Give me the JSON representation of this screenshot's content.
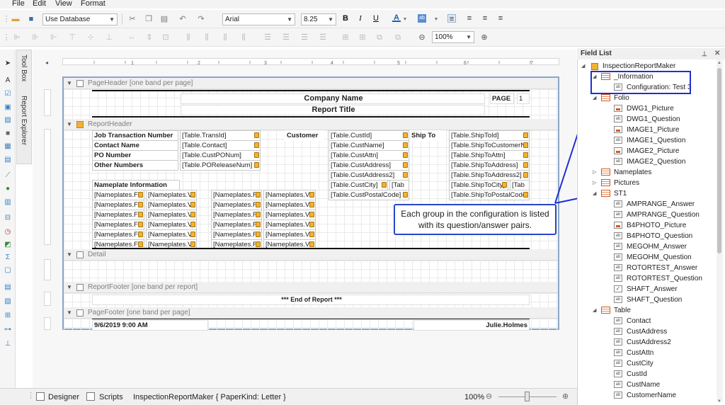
{
  "menu": [
    "File",
    "Edit",
    "View",
    "Format"
  ],
  "toolbar1": {
    "datasource": "Use Database",
    "font": "Arial",
    "size": "8.25",
    "bold": "B",
    "italic": "I",
    "underline": "U",
    "fontcolor": "A"
  },
  "toolbar2": {
    "zoom": "100%"
  },
  "vtabs": [
    "Tool Box",
    "Report Explorer"
  ],
  "bands": {
    "pageheader": "PageHeader [one band per page]",
    "reportheader": "ReportHeader",
    "detail": "Detail",
    "reportfooter": "ReportFooter [one band per report]",
    "pagefooter": "PageFooter [one band per page]"
  },
  "header": {
    "company": "Company Name",
    "title": "Report Title",
    "page": "PAGE",
    "pagenum": "1"
  },
  "rh": {
    "labels": [
      "Job Transaction Number",
      "Contact Name",
      "PO Number",
      "Other Numbers"
    ],
    "values": [
      "[Table.TransId]",
      "[Table.Contact]",
      "[Table.CustPONum]",
      "[Table.POReleaseNum]"
    ],
    "customer_lbl": "Customer",
    "customer": [
      "[Table.CustId]",
      "[Table.CustName]",
      "[Table.CustAttn]",
      "[Table.CustAddress]",
      "[Table.CustAddress2]",
      "[Table.CustCity]",
      "[Table.CustPostalCode]"
    ],
    "shipto_lbl": "Ship To",
    "shipto": [
      "[Table.ShipToId]",
      "[Table.ShipToCustomerN",
      "[Table.ShipToAttn]",
      "[Table.ShipToAddress]",
      "[Table.ShipToAddress2]",
      "[Table.ShipToCity]",
      "[Table.ShipToPostalCode"
    ],
    "tab": "[Tab",
    "nameplate_lbl": "Nameplate Information",
    "np_f": "[Nameplates.F",
    "np_v": "[Nameplates.V"
  },
  "footer": {
    "end": "*** End of Report ***",
    "date": "9/6/2019 9:00 AM",
    "user": "Julie.Holmes"
  },
  "callout": "Each group in the configuration is listed with its question/answer pairs.",
  "fieldlist": {
    "title": "Field List",
    "root": "InspectionReportMaker",
    "items": [
      {
        "lvl": 1,
        "icon": "tbl",
        "caret": "open",
        "text": "_Information"
      },
      {
        "lvl": 2,
        "icon": "ab",
        "caret": "",
        "text": "Configuration: Test 3"
      },
      {
        "lvl": 1,
        "icon": "tbl",
        "caret": "open",
        "text": "Folio"
      },
      {
        "lvl": 2,
        "icon": "pic",
        "caret": "",
        "text": "DWG1_Picture"
      },
      {
        "lvl": 2,
        "icon": "ab",
        "caret": "",
        "text": "DWG1_Question"
      },
      {
        "lvl": 2,
        "icon": "pic",
        "caret": "",
        "text": "IMAGE1_Picture"
      },
      {
        "lvl": 2,
        "icon": "ab",
        "caret": "",
        "text": "IMAGE1_Question"
      },
      {
        "lvl": 2,
        "icon": "pic",
        "caret": "",
        "text": "IMAGE2_Picture"
      },
      {
        "lvl": 2,
        "icon": "ab",
        "caret": "",
        "text": "IMAGE2_Question"
      },
      {
        "lvl": 1,
        "icon": "tbl",
        "caret": "closed",
        "text": "Nameplates"
      },
      {
        "lvl": 1,
        "icon": "tbl",
        "caret": "closed",
        "text": "Pictures"
      },
      {
        "lvl": 1,
        "icon": "tbl",
        "caret": "open",
        "text": "ST1"
      },
      {
        "lvl": 2,
        "icon": "ab",
        "caret": "",
        "text": "AMPRANGE_Answer"
      },
      {
        "lvl": 2,
        "icon": "ab",
        "caret": "",
        "text": "AMPRANGE_Question"
      },
      {
        "lvl": 2,
        "icon": "pic",
        "caret": "",
        "text": "B4PHOTO_Picture"
      },
      {
        "lvl": 2,
        "icon": "ab",
        "caret": "",
        "text": "B4PHOTO_Question"
      },
      {
        "lvl": 2,
        "icon": "ab",
        "caret": "",
        "text": "MEGOHM_Answer"
      },
      {
        "lvl": 2,
        "icon": "ab",
        "caret": "",
        "text": "MEGOHM_Question"
      },
      {
        "lvl": 2,
        "icon": "ab",
        "caret": "",
        "text": "ROTORTEST_Answer"
      },
      {
        "lvl": 2,
        "icon": "ab",
        "caret": "",
        "text": "ROTORTEST_Question"
      },
      {
        "lvl": 2,
        "icon": "chk",
        "caret": "",
        "text": "SHAFT_Answer"
      },
      {
        "lvl": 2,
        "icon": "ab",
        "caret": "",
        "text": "SHAFT_Question"
      },
      {
        "lvl": 1,
        "icon": "tbl",
        "caret": "open",
        "text": "Table"
      },
      {
        "lvl": 2,
        "icon": "ab",
        "caret": "",
        "text": "Contact"
      },
      {
        "lvl": 2,
        "icon": "ab",
        "caret": "",
        "text": "CustAddress"
      },
      {
        "lvl": 2,
        "icon": "ab",
        "caret": "",
        "text": "CustAddress2"
      },
      {
        "lvl": 2,
        "icon": "ab",
        "caret": "",
        "text": "CustAttn"
      },
      {
        "lvl": 2,
        "icon": "ab",
        "caret": "",
        "text": "CustCity"
      },
      {
        "lvl": 2,
        "icon": "ab",
        "caret": "",
        "text": "CustId"
      },
      {
        "lvl": 2,
        "icon": "ab",
        "caret": "",
        "text": "CustName"
      },
      {
        "lvl": 2,
        "icon": "ab",
        "caret": "",
        "text": "CustomerName"
      }
    ]
  },
  "status": {
    "designer": "Designer",
    "scripts": "Scripts",
    "doc": "InspectionReportMaker { PaperKind: Letter }",
    "zoom": "100%"
  }
}
